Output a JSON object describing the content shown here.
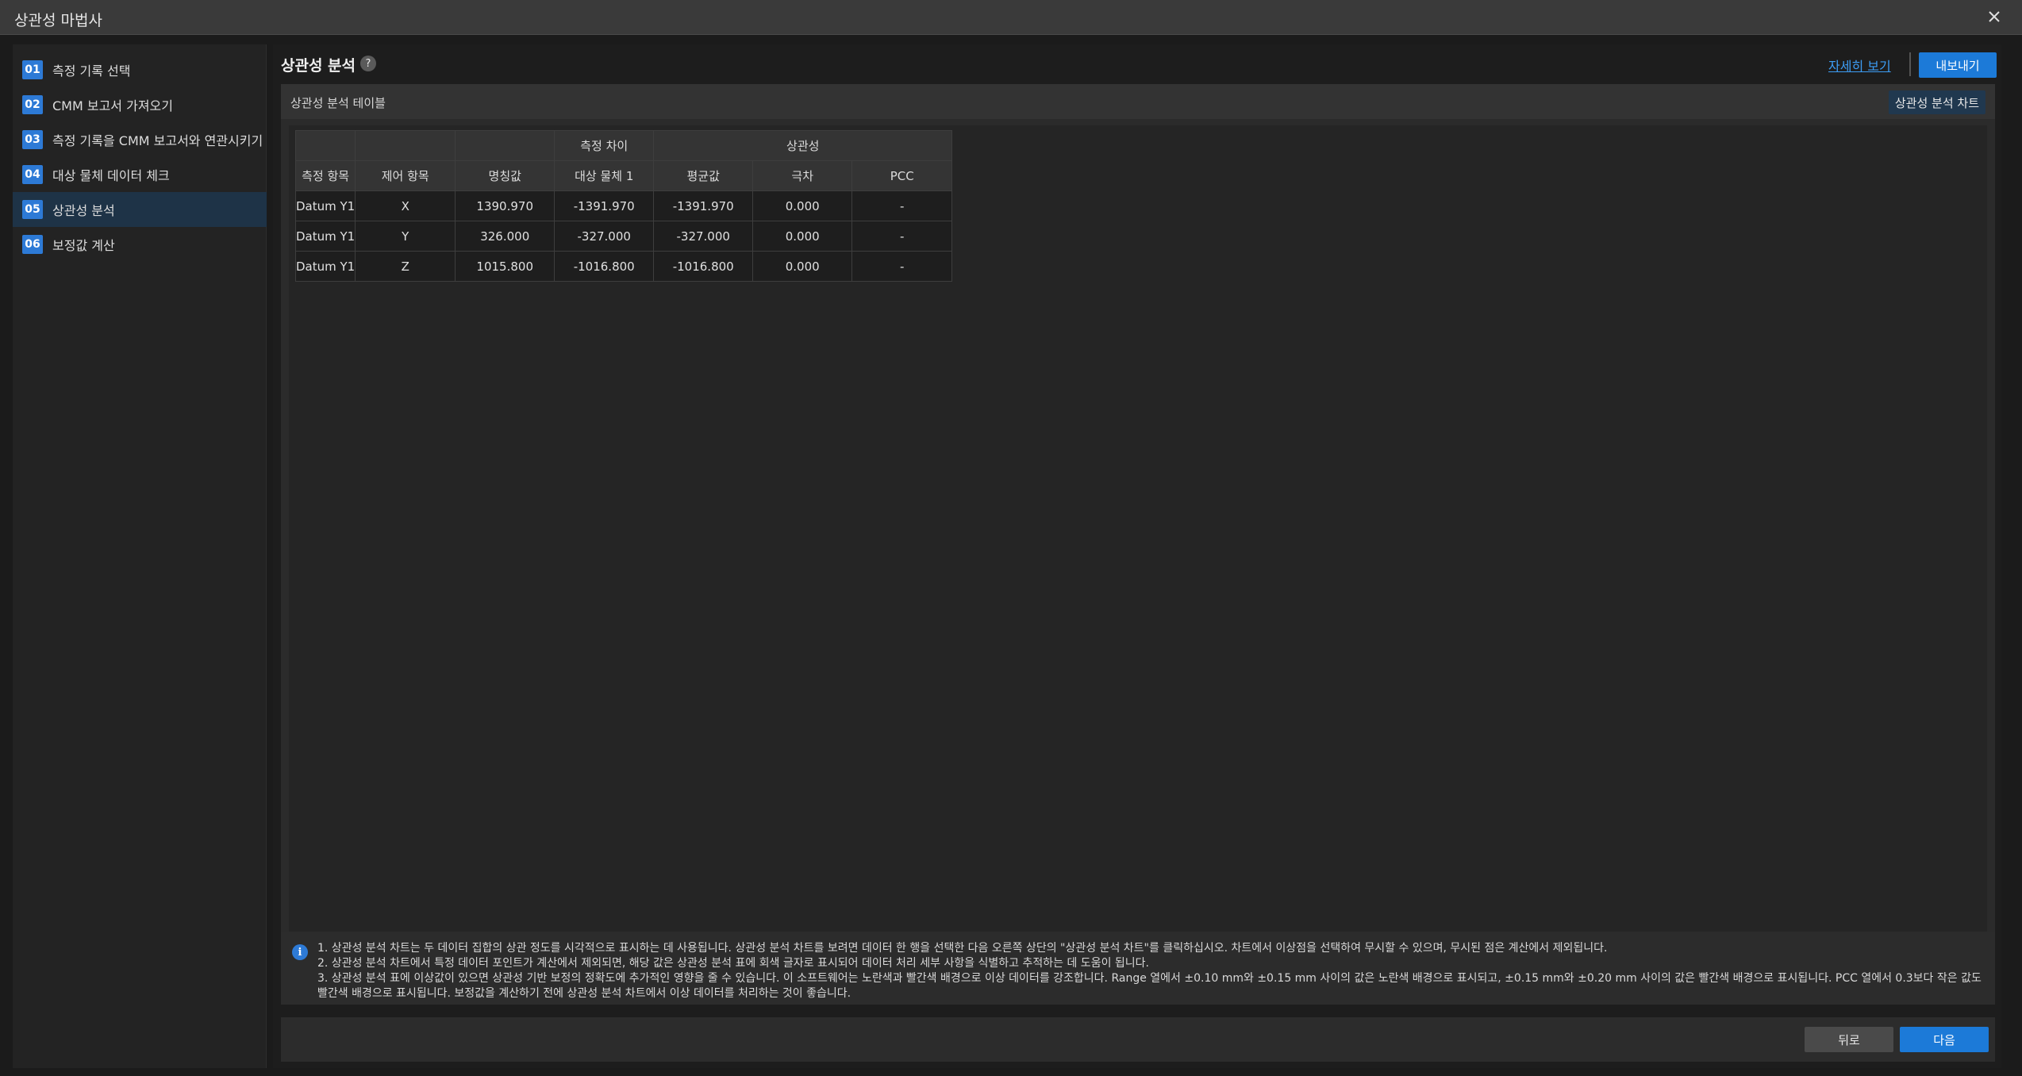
{
  "window": {
    "title": "상관성 마법사",
    "close_icon": "×"
  },
  "steps": [
    {
      "num": "01",
      "label": "측정 기록 선택"
    },
    {
      "num": "02",
      "label": "CMM 보고서 가져오기"
    },
    {
      "num": "03",
      "label": "측정 기록을 CMM 보고서와 연관시키기"
    },
    {
      "num": "04",
      "label": "대상 물체 데이터 체크"
    },
    {
      "num": "05",
      "label": "상관성 분석"
    },
    {
      "num": "06",
      "label": "보정값 계산"
    }
  ],
  "active_step": "05",
  "header": {
    "title": "상관성 분석",
    "help": "?",
    "detail_link": "자세히 보기",
    "export_button": "내보내기"
  },
  "panel": {
    "title": "상관성 분석 테이블",
    "chart_button": "상관성 분석 차트"
  },
  "table": {
    "group_headers": {
      "diff": "측정 차이",
      "corr": "상관성"
    },
    "columns": [
      "측정 항목",
      "제어 항목",
      "명칭값",
      "대상 물체 1",
      "평균값",
      "극차",
      "PCC"
    ],
    "rows": [
      [
        "Datum Y1",
        "X",
        "1390.970",
        "-1391.970",
        "-1391.970",
        "0.000",
        "-"
      ],
      [
        "Datum Y1",
        "Y",
        "326.000",
        "-327.000",
        "-327.000",
        "0.000",
        "-"
      ],
      [
        "Datum Y1",
        "Z",
        "1015.800",
        "-1016.800",
        "-1016.800",
        "0.000",
        "-"
      ]
    ]
  },
  "info": {
    "icon": "i",
    "lines": [
      "1. 상관성 분석 차트는 두 데이터 집합의 상관 정도를 시각적으로 표시하는 데 사용됩니다. 상관성 분석 차트를 보려면 데이터 한 행을 선택한 다음 오른쪽 상단의 \"상관성 분석 차트\"를 클릭하십시오. 차트에서 이상점을 선택하여 무시할 수 있으며, 무시된 점은 계산에서 제외됩니다.",
      "2. 상관성 분석 차트에서 특정 데이터 포인트가 계산에서 제외되면, 해당 값은 상관성 분석 표에 회색 글자로 표시되어 데이터 처리 세부 사항을 식별하고 추적하는 데 도움이 됩니다.",
      "3. 상관성 분석 표에 이상값이 있으면 상관성 기반 보정의 정확도에 추가적인 영향을 줄 수 있습니다. 이 소프트웨어는 노란색과 빨간색 배경으로 이상 데이터를 강조합니다. Range 열에서 ±0.10 mm와 ±0.15 mm 사이의 값은 노란색 배경으로 표시되고, ±0.15 mm와 ±0.20 mm 사이의 값은 빨간색 배경으로 표시됩니다. PCC 열에서 0.3보다 작은 값도 빨간색 배경으로 표시됩니다. 보정값을 계산하기 전에 상관성 분석 차트에서 이상 데이터를 처리하는 것이 좋습니다."
    ]
  },
  "footer": {
    "back_button": "뒤로",
    "next_button": "다음"
  }
}
